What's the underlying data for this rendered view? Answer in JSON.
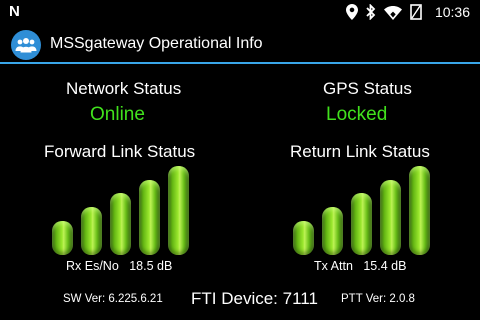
{
  "statusbar": {
    "left_glyph": "N",
    "icons": [
      "location-pin-icon",
      "bluetooth-icon",
      "wifi-icon",
      "battery-icon"
    ],
    "time": "10:36"
  },
  "app": {
    "title": "MSSgateway Operational Info",
    "accent_color": "#39a6e8"
  },
  "network": {
    "label": "Network Status",
    "value": "Online"
  },
  "gps": {
    "label": "GPS Status",
    "value": "Locked"
  },
  "forward_link": {
    "label": "Forward Link Status",
    "metric_label": "Rx Es/No",
    "metric_value": "18.5 dB",
    "bars_lit": 5,
    "bars_total": 5
  },
  "return_link": {
    "label": "Return Link Status",
    "metric_label": "Tx Attn",
    "metric_value": "15.4 dB",
    "bars_lit": 5,
    "bars_total": 5
  },
  "footer": {
    "sw_ver": "SW Ver: 6.225.6.21",
    "device": "FTI Device: 7111",
    "ptt_ver": "PTT Ver: 2.0.8"
  },
  "colors": {
    "status_green": "#41e11d",
    "bar_green": "#9be82e",
    "background": "#000000"
  }
}
